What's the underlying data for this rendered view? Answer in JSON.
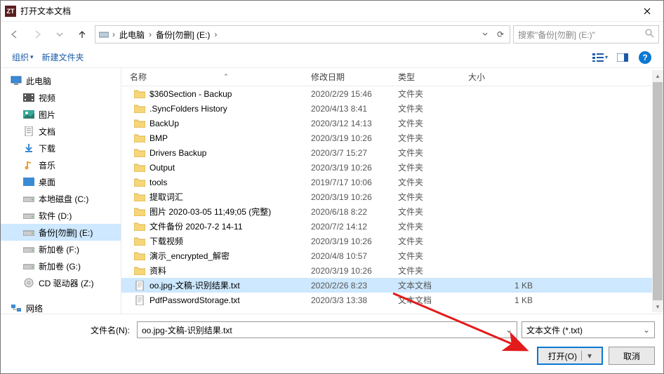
{
  "title": "打开文本文档",
  "app_icon_text": "ZT",
  "breadcrumb": {
    "segments": [
      "此电脑",
      "备份[勿删] (E:)"
    ],
    "refresh_glyph": "⟳"
  },
  "search": {
    "placeholder": "搜索\"备份[勿删] (E:)\""
  },
  "toolbar": {
    "organize": "组织",
    "new_folder": "新建文件夹"
  },
  "columns": {
    "name": "名称",
    "date": "修改日期",
    "type": "类型",
    "size": "大小"
  },
  "sidebar": [
    {
      "icon": "pc",
      "label": "此电脑",
      "level": 1
    },
    {
      "icon": "video",
      "label": "视频",
      "level": 2
    },
    {
      "icon": "picture",
      "label": "图片",
      "level": 2
    },
    {
      "icon": "doc",
      "label": "文档",
      "level": 2
    },
    {
      "icon": "download",
      "label": "下载",
      "level": 2
    },
    {
      "icon": "music",
      "label": "音乐",
      "level": 2
    },
    {
      "icon": "desktop",
      "label": "桌面",
      "level": 2
    },
    {
      "icon": "drive",
      "label": "本地磁盘 (C:)",
      "level": 2
    },
    {
      "icon": "drive",
      "label": "软件 (D:)",
      "level": 2
    },
    {
      "icon": "drive",
      "label": "备份[勿删] (E:)",
      "level": 2,
      "selected": true
    },
    {
      "icon": "drive",
      "label": "新加卷 (F:)",
      "level": 2
    },
    {
      "icon": "drive",
      "label": "新加卷 (G:)",
      "level": 2
    },
    {
      "icon": "cd",
      "label": "CD 驱动器 (Z:)",
      "level": 2
    },
    {
      "icon": "net",
      "label": "网络",
      "level": 1
    }
  ],
  "files": [
    {
      "icon": "folder",
      "name": "$360Section - Backup",
      "date": "2020/2/29 15:46",
      "type": "文件夹",
      "size": ""
    },
    {
      "icon": "folder",
      "name": ".SyncFolders History",
      "date": "2020/4/13 8:41",
      "type": "文件夹",
      "size": ""
    },
    {
      "icon": "folder",
      "name": "BackUp",
      "date": "2020/3/12 14:13",
      "type": "文件夹",
      "size": ""
    },
    {
      "icon": "folder",
      "name": "BMP",
      "date": "2020/3/19 10:26",
      "type": "文件夹",
      "size": ""
    },
    {
      "icon": "folder",
      "name": "Drivers Backup",
      "date": "2020/3/7 15:27",
      "type": "文件夹",
      "size": ""
    },
    {
      "icon": "folder",
      "name": "Output",
      "date": "2020/3/19 10:26",
      "type": "文件夹",
      "size": ""
    },
    {
      "icon": "folder",
      "name": "tools",
      "date": "2019/7/17 10:06",
      "type": "文件夹",
      "size": ""
    },
    {
      "icon": "folder",
      "name": "提取词汇",
      "date": "2020/3/19 10:26",
      "type": "文件夹",
      "size": ""
    },
    {
      "icon": "folder",
      "name": "图片 2020-03-05 11;49;05 (完整)",
      "date": "2020/6/18 8:22",
      "type": "文件夹",
      "size": ""
    },
    {
      "icon": "folder",
      "name": "文件备份 2020-7-2 14-11",
      "date": "2020/7/2 14:12",
      "type": "文件夹",
      "size": ""
    },
    {
      "icon": "folder",
      "name": "下载视频",
      "date": "2020/3/19 10:26",
      "type": "文件夹",
      "size": ""
    },
    {
      "icon": "folder",
      "name": "演示_encrypted_解密",
      "date": "2020/4/8 10:57",
      "type": "文件夹",
      "size": ""
    },
    {
      "icon": "folder",
      "name": "资料",
      "date": "2020/3/19 10:26",
      "type": "文件夹",
      "size": ""
    },
    {
      "icon": "txt",
      "name": "oo.jpg-文稿-识别结果.txt",
      "date": "2020/2/26 8:23",
      "type": "文本文档",
      "size": "1 KB",
      "selected": true
    },
    {
      "icon": "txt",
      "name": "PdfPasswordStorage.txt",
      "date": "2020/3/3 13:38",
      "type": "文本文档",
      "size": "1 KB"
    }
  ],
  "footer": {
    "filename_label": "文件名(N):",
    "filename_value": "oo.jpg-文稿-识别结果.txt",
    "filter_label": "文本文件 (*.txt)",
    "open_label": "打开(O)",
    "cancel_label": "取消"
  }
}
